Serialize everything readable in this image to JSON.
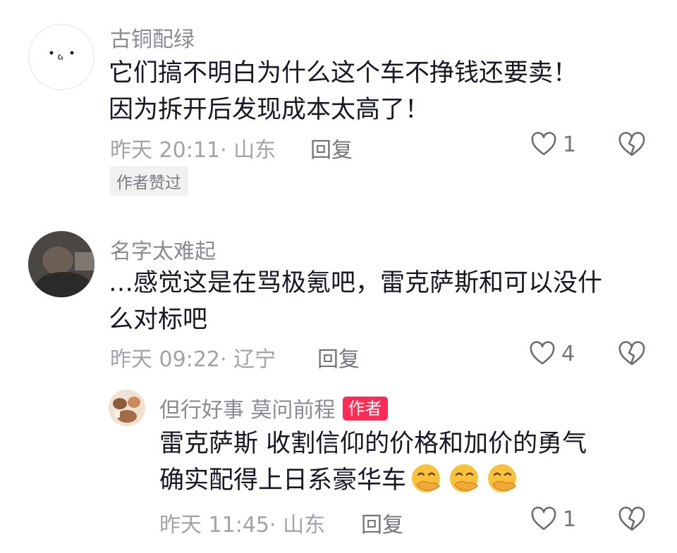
{
  "comments": [
    {
      "username": "古铜配绿",
      "text_line1": "它们搞不明白为什么这个车不挣钱还要卖！",
      "text_line2": "因为拆开后发现成本太高了！",
      "meta": "昨天 20:11· 山东",
      "reply_label": "回复",
      "likes": "1",
      "liked_by_author_label": "作者赞过"
    },
    {
      "username": "名字太难起",
      "text_line1": "…感觉这是在骂极氪吧，雷克萨斯和可以没什",
      "text_line2": "么对标吧",
      "meta": "昨天 09:22· 辽宁",
      "reply_label": "回复",
      "likes": "4"
    }
  ],
  "reply": {
    "username": "但行好事 莫问前程",
    "author_badge": "作者",
    "text_line1": "雷克萨斯 收割信仰的价格和加价的勇气",
    "text_line2": "确实配得上日系豪华车",
    "emoji_names": [
      "hand-over-mouth-emoji",
      "hand-over-mouth-emoji",
      "hand-over-mouth-emoji"
    ],
    "meta": "昨天 11:45· 山东",
    "reply_label": "回复",
    "likes": "1"
  },
  "colors": {
    "text": "#161823",
    "username": "#8a8b91",
    "meta": "#a2a3a8",
    "author_badge": "#fe2c55",
    "emoji": "#f7c23a"
  }
}
